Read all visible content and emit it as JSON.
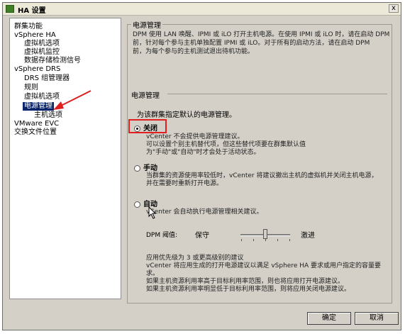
{
  "window": {
    "title": "HA 设置",
    "close_glyph": "x"
  },
  "tree": {
    "items": [
      {
        "label": "群集功能"
      },
      {
        "label": "vSphere HA"
      },
      {
        "label": "虚拟机选项"
      },
      {
        "label": "虚拟机监控"
      },
      {
        "label": "数据存储检测信号"
      },
      {
        "label": "vSphere DRS"
      },
      {
        "label": "DRS 组管理器"
      },
      {
        "label": "规则"
      },
      {
        "label": "虚拟机选项"
      },
      {
        "label": "电源管理"
      },
      {
        "label": "主机选项"
      },
      {
        "label": "VMware EVC"
      },
      {
        "label": "交换文件位置"
      }
    ],
    "selected": "电源管理"
  },
  "panel": {
    "title": "电源管理",
    "intro": [
      "DPM 使用 LAN 唤醒、IPMI 或 iLO 打开主机电源。在使用 IPMI 或 iLO 时，请在启动 DPM",
      "前，针对每个参与主机单独配置 IPMI 或 iLO。对于所有的启动方法，请在启动 DPM",
      "前，为每个参与的主机测试退出待机功能。"
    ],
    "section_label": "电源管理",
    "default_prompt": "为该群集指定默认的电源管理。",
    "options": [
      {
        "label": "关闭",
        "checked": true,
        "desc": [
          "vCenter 不会提供电源管理建议。",
          "可以设置个别主机替代项，但这些替代项要在群集默认值",
          "为\"手动\"或\"自动\"时才会处于活动状态。"
        ]
      },
      {
        "label": "手动",
        "checked": false,
        "desc": [
          "当群集的资源使用率较低时，vCenter 将建议撤出主机的虚拟机并关闭主机电源，",
          "并在需要时重新打开电源。"
        ]
      },
      {
        "label": "自动",
        "checked": false,
        "desc": [
          "vCenter 会自动执行电源管理相关建议。"
        ]
      }
    ],
    "threshold": {
      "label": "DPM 阈值:",
      "left": "保守",
      "right": "激进",
      "level": 0.5
    },
    "threshold_desc": [
      "应用优先级为 3 或更高级别的建议",
      "vCenter 将应用生成的打开电源建议以满足 vSphere HA 要求或用户指定的容量要",
      "求。",
      "如果主机资源利用率高于目标利用率范围，则也将应用打开电源建议。",
      "如果主机资源利用率明显低于目标利用率范围，则将应用关闭电源建议。"
    ]
  },
  "buttons": {
    "ok": "确定",
    "cancel": "取消"
  },
  "colors": {
    "highlight_box": "#e02020",
    "selection": "#0a246a"
  }
}
